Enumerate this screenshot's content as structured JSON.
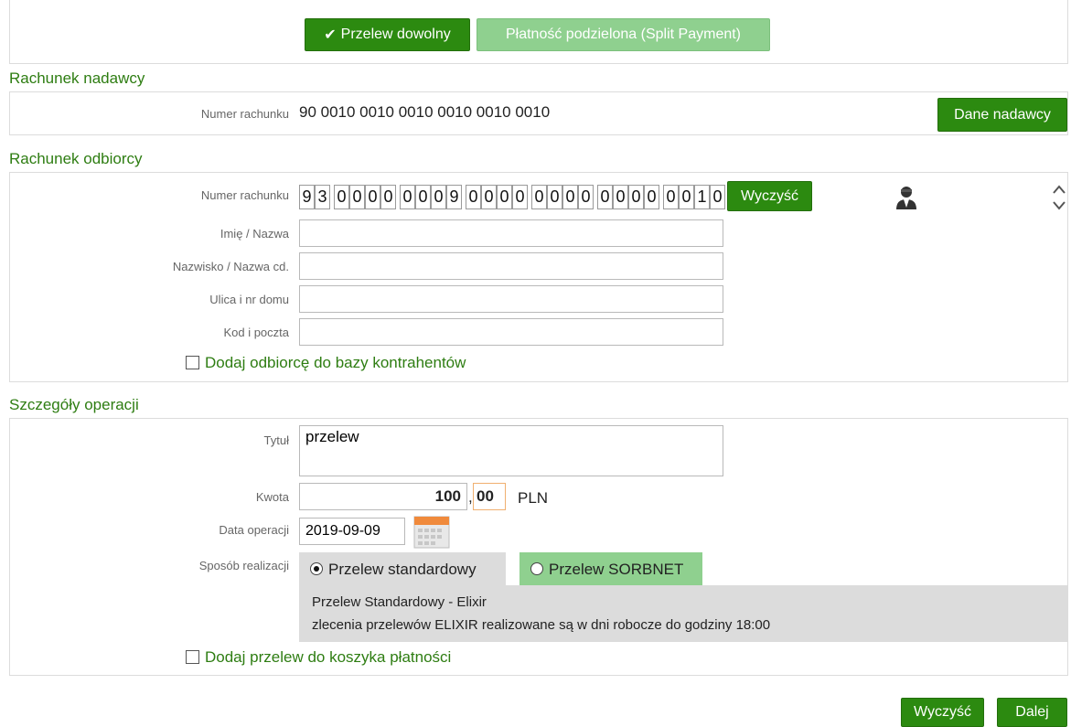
{
  "top_tabs": {
    "check_glyph": "✔",
    "free_transfer": "Przelew dowolny",
    "split_payment": "Płatność podzielona (Split Payment)"
  },
  "sender": {
    "section_title": "Rachunek nadawcy",
    "account_label": "Numer rachunku",
    "account_number": "90 0010 0010 0010 0010 0010 0010",
    "sender_data_button": "Dane nadawcy"
  },
  "recipient": {
    "section_title": "Rachunek odbiorcy",
    "account_label": "Numer rachunku",
    "account_digits": [
      "9",
      "3",
      "0",
      "0",
      "0",
      "0",
      "0",
      "0",
      "0",
      "9",
      "0",
      "0",
      "0",
      "0",
      "0",
      "0",
      "0",
      "0",
      "0",
      "0",
      "0",
      "0",
      "0",
      "0",
      "1",
      "0"
    ],
    "clear_button": "Wyczyść",
    "name_label": "Imię / Nazwa",
    "name_value": "",
    "surname_label": "Nazwisko / Nazwa cd.",
    "surname_value": "",
    "street_label": "Ulica i nr domu",
    "street_value": "",
    "postal_label": "Kod i poczta",
    "postal_value": "",
    "add_to_contacts": "Dodaj odbiorcę do bazy kontrahentów",
    "add_to_contacts_checked": false,
    "contact_icon": "person-icon",
    "scroll_up": "^",
    "scroll_down": "v"
  },
  "operation": {
    "section_title": "Szczegóły operacji",
    "title_label": "Tytuł",
    "title_value": "przelew",
    "amount_label": "Kwota",
    "amount_whole": "100",
    "amount_sep": ",",
    "amount_cents": "00",
    "currency": "PLN",
    "date_label": "Data operacji",
    "date_value": "2019-09-09",
    "calendar_icon": "calendar-icon",
    "method_label": "Sposób realizacji",
    "method_standard": "Przelew standardowy",
    "method_sorbnet": "Przelew SORBNET",
    "selected_method": "standard",
    "info_line1": "Przelew Standardowy - Elixir",
    "info_line2": "zlecenia przelewów ELIXIR realizowane są w dni robocze do godziny 18:00",
    "add_to_basket": "Dodaj przelew do koszyka płatności",
    "add_to_basket_checked": false
  },
  "footer": {
    "clear_button": "Wyczyść",
    "next_button": "Dalej"
  },
  "colors": {
    "accent_dark": "#2c8a10",
    "accent_light": "#8fd08f",
    "section_title": "#2e7d12"
  }
}
